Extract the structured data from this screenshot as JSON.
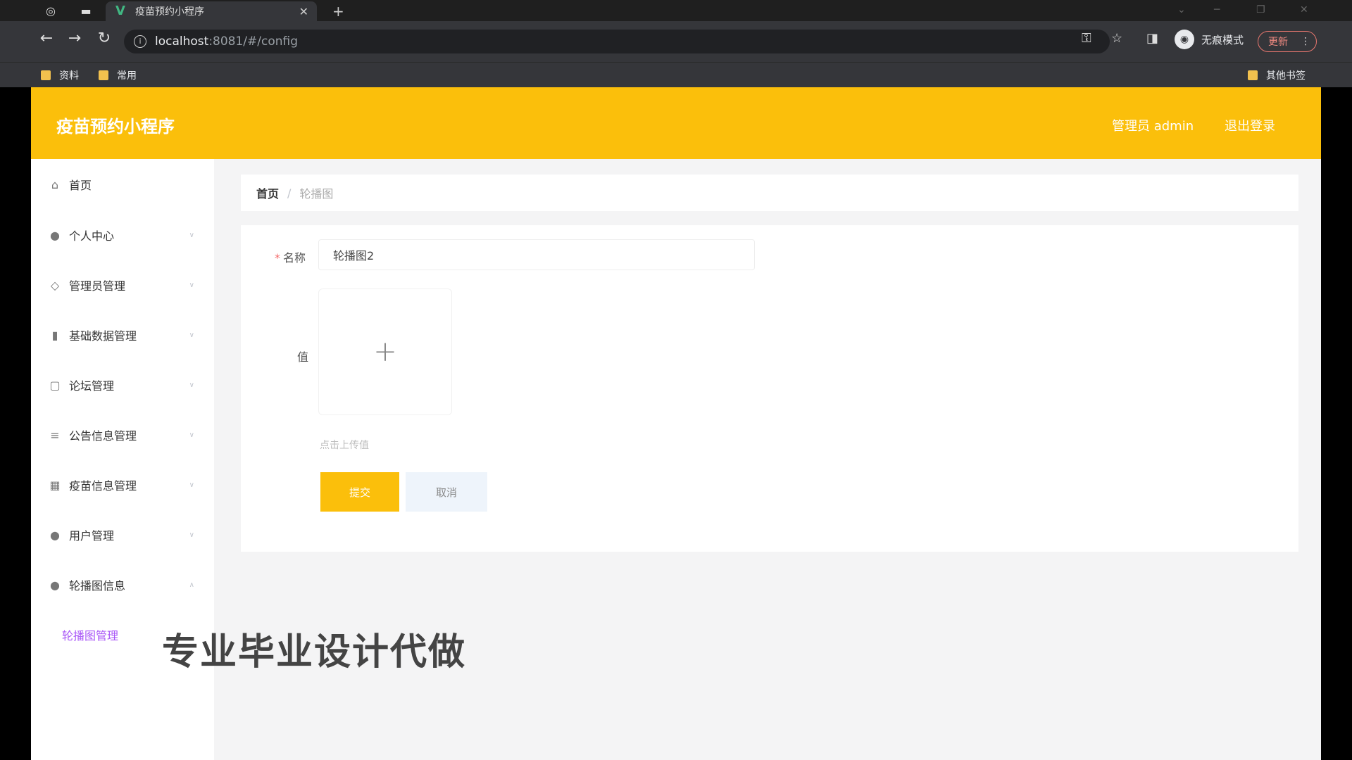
{
  "browser": {
    "tab_title": "疫苗预约小程序",
    "tab_favicon": "vue-icon",
    "url_host": "localhost",
    "url_rest": ":8081/#/config",
    "incognito_label": "无痕模式",
    "update_label": "更新",
    "bookmarks": [
      "资料",
      "常用"
    ],
    "other_bookmarks": "其他书签"
  },
  "header": {
    "app_title": "疫苗预约小程序",
    "admin_label": "管理员 admin",
    "logout_label": "退出登录",
    "color": "#fbbf0b"
  },
  "sidebar": {
    "items": [
      {
        "label": "首页",
        "icon": "home-icon"
      },
      {
        "label": "个人中心",
        "icon": "user-icon"
      },
      {
        "label": "管理员管理",
        "icon": "admin-icon"
      },
      {
        "label": "基础数据管理",
        "icon": "chart-icon"
      },
      {
        "label": "论坛管理",
        "icon": "forum-icon"
      },
      {
        "label": "公告信息管理",
        "icon": "list-icon"
      },
      {
        "label": "疫苗信息管理",
        "icon": "grid-icon"
      },
      {
        "label": "用户管理",
        "icon": "user-icon"
      },
      {
        "label": "轮播图信息",
        "icon": "user-icon"
      }
    ],
    "submenu_active": "轮播图管理"
  },
  "breadcrumb": {
    "home": "首页",
    "separator": "/",
    "current": "轮播图"
  },
  "form": {
    "name_label": "名称",
    "name_value": "轮播图2",
    "value_label": "值",
    "upload_plus": "+",
    "upload_tip": "点击上传值",
    "submit_label": "提交",
    "cancel_label": "取消"
  },
  "watermark": "专业毕业设计代做"
}
